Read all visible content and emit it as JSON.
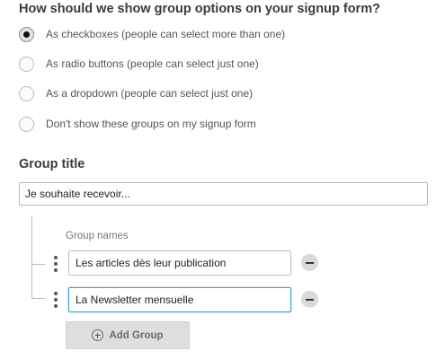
{
  "display_options": {
    "heading": "How should we show group options on your signup form?",
    "selected": "checkboxes",
    "options": [
      {
        "id": "checkboxes",
        "label": "As checkboxes (people can select more than one)"
      },
      {
        "id": "radio",
        "label": "As radio buttons (people can select just one)"
      },
      {
        "id": "dropdown",
        "label": "As a dropdown (people can select just one)"
      },
      {
        "id": "hidden",
        "label": "Don't show these groups on my signup form"
      }
    ]
  },
  "group_title": {
    "heading": "Group title",
    "value": "Je souhaite recevoir..."
  },
  "group_names": {
    "label": "Group names",
    "items": [
      {
        "value": "Les articles dès leur publication"
      },
      {
        "value": "La Newsletter mensuelle"
      }
    ],
    "add_button_label": "Add Group"
  },
  "icons": {
    "drag": "drag-handle-icon",
    "remove": "minus-circle-icon",
    "add": "plus-circle-icon"
  },
  "colors": {
    "focus_border": "#3aa3c9",
    "button_bg": "#dedede",
    "remove_bg": "#d9d9d9"
  }
}
